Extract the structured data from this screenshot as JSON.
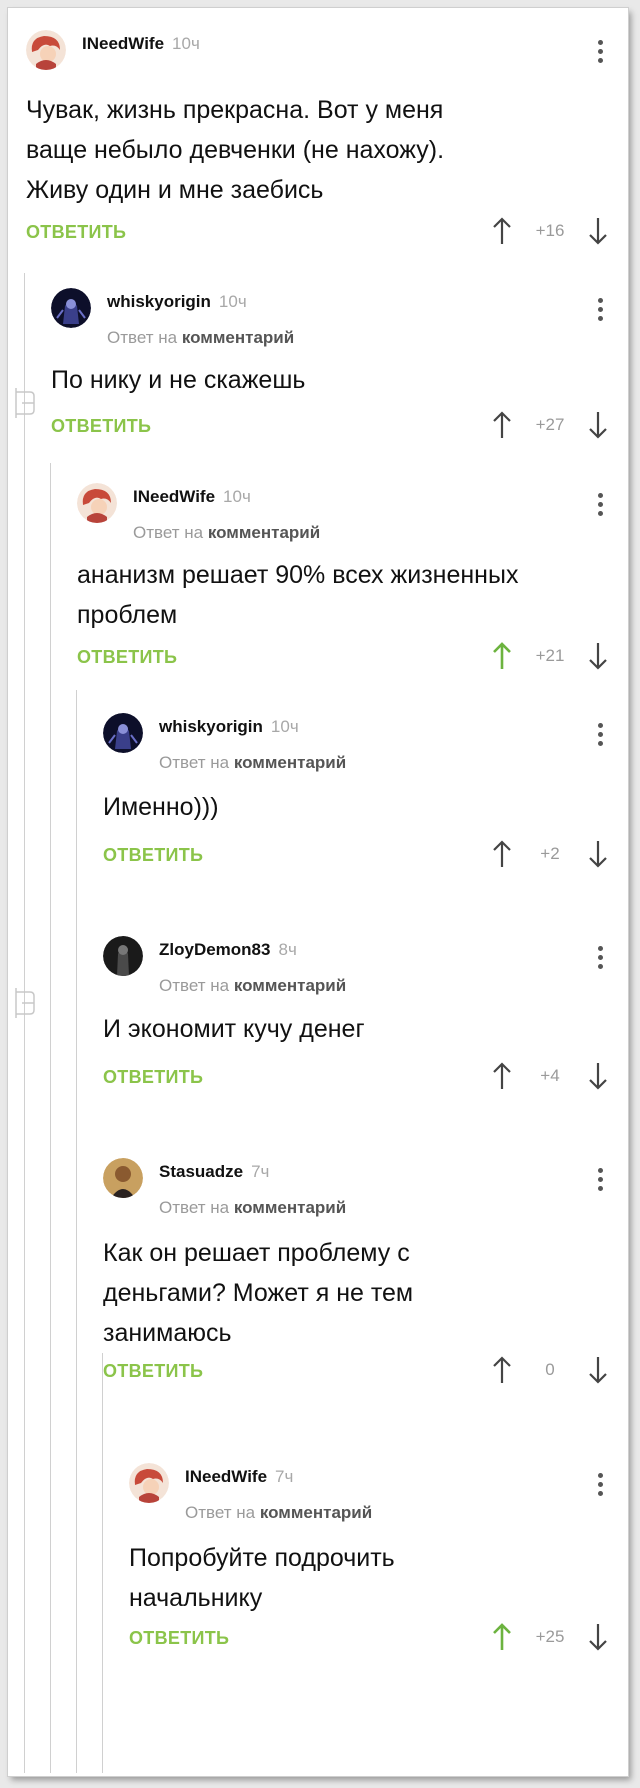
{
  "reply_label": "ОТВЕТИТЬ",
  "reply_to_prefix": "Ответ на",
  "reply_to_link": "комментарий",
  "accent_color": "#8bc44a",
  "comments": [
    {
      "author": "INeedWife",
      "time": "10ч",
      "text": "Чувак, жизнь прекрасна. Вот у меня ваще небыло девченки (не нахожу). Живу один и мне заебись",
      "score": "+16",
      "upvoted": false
    },
    {
      "author": "whiskyorigin",
      "time": "10ч",
      "text": "По нику и не скажешь",
      "score": "+27",
      "upvoted": false
    },
    {
      "author": "INeedWife",
      "time": "10ч",
      "text": "ананизм решает 90% всех жизненных проблем",
      "score": "+21",
      "upvoted": true
    },
    {
      "author": "whiskyorigin",
      "time": "10ч",
      "text": "Именно)))",
      "score": "+2",
      "upvoted": false
    },
    {
      "author": "ZloyDemon83",
      "time": "8ч",
      "text": "И экономит кучу денег",
      "score": "+4",
      "upvoted": false
    },
    {
      "author": "Stasuadze",
      "time": "7ч",
      "text": "Как он решает проблему с деньгами? Может я не тем занимаюсь",
      "score": "0",
      "upvoted": false
    },
    {
      "author": "INeedWife",
      "time": "7ч",
      "text": "Попробуйте подрочить начальнику",
      "score": "+25",
      "upvoted": true
    }
  ]
}
